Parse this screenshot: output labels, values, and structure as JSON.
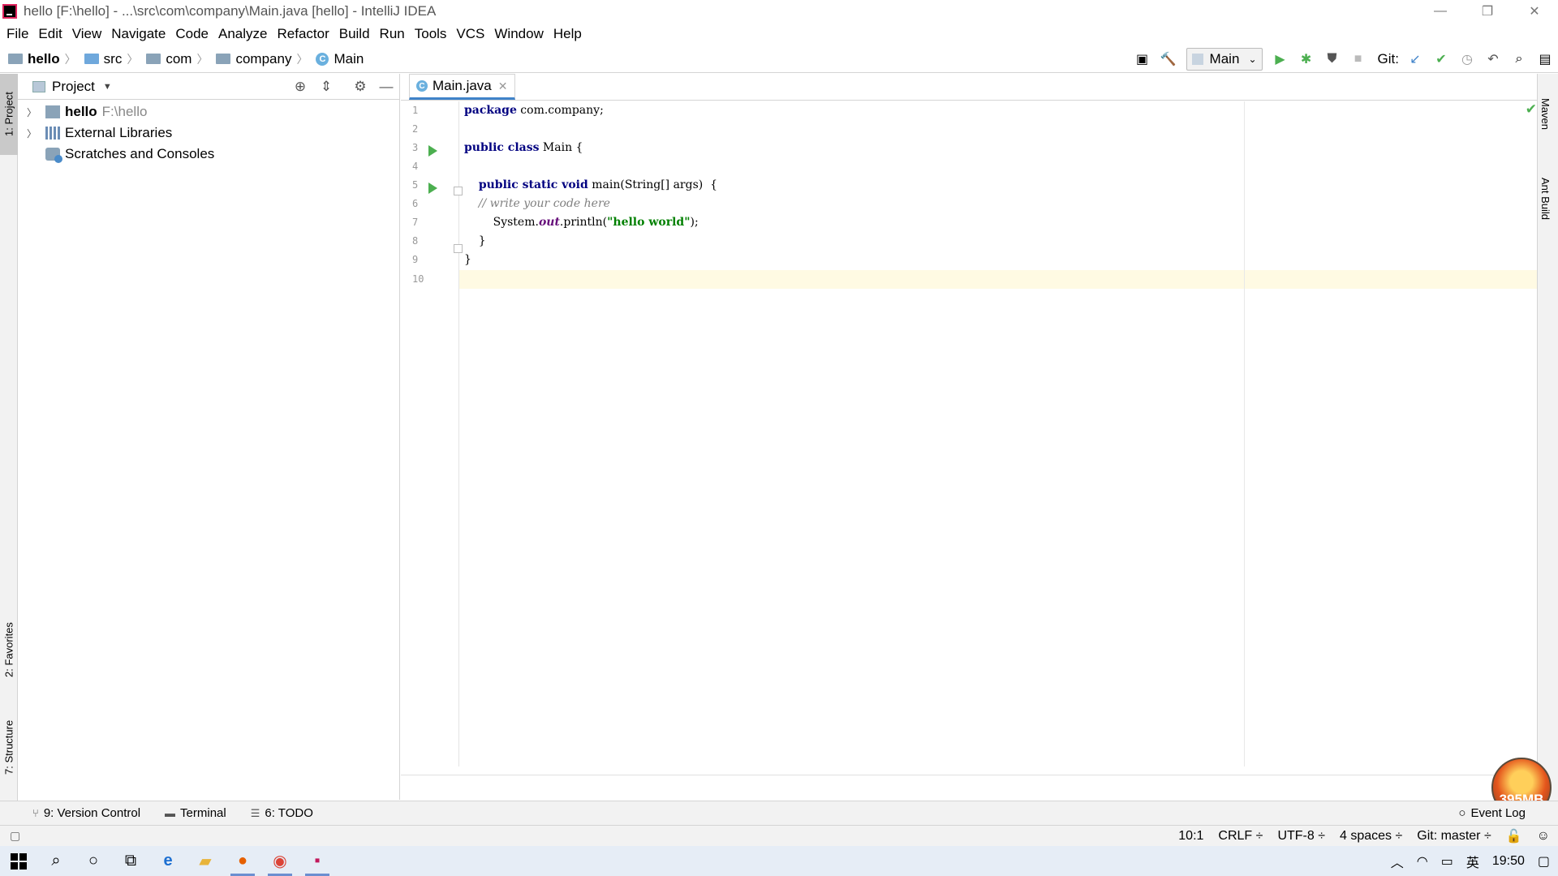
{
  "window": {
    "title": "hello [F:\\hello] - ...\\src\\com\\company\\Main.java [hello] - IntelliJ IDEA",
    "controls": [
      "—",
      "❐",
      "✕"
    ]
  },
  "menu": [
    {
      "label": "File"
    },
    {
      "label": "Edit"
    },
    {
      "label": "View"
    },
    {
      "label": "Navigate"
    },
    {
      "label": "Code"
    },
    {
      "label": "Analyze"
    },
    {
      "label": "Refactor"
    },
    {
      "label": "Build"
    },
    {
      "label": "Run"
    },
    {
      "label": "Tools"
    },
    {
      "label": "VCS"
    },
    {
      "label": "Window"
    },
    {
      "label": "Help"
    }
  ],
  "breadcrumb": {
    "project": "hello",
    "items": [
      "src",
      "com",
      "company"
    ],
    "file": "Main"
  },
  "toolbar": {
    "run_config": "Main",
    "git_label": "Git:"
  },
  "left_strip": {
    "project": "1: Project",
    "favorites": "2: Favorites",
    "structure": "7: Structure"
  },
  "right_strip": {
    "maven": "Maven",
    "ant": "Ant Build"
  },
  "project_panel": {
    "title": "Project",
    "tree": [
      {
        "name": "hello",
        "path": "F:\\hello"
      },
      {
        "name": "External Libraries"
      },
      {
        "name": "Scratches and Consoles"
      }
    ]
  },
  "editor": {
    "tab_label": "Main.java",
    "line_numbers": [
      "1",
      "2",
      "3",
      "4",
      "5",
      "6",
      "7",
      "8",
      "9",
      "10"
    ],
    "lines": {
      "l1_kw": "package",
      "l1_rest": " com.company;",
      "l3_kw": "public class",
      "l3_rest": " Main {",
      "l5_indent": "    ",
      "l5_kw": "public static void",
      "l5_rest": " main(String[] args)  {",
      "l6_comment": "    // write your code here",
      "l7_pre": "        System.",
      "l7_field": "out",
      "l7_mid": ".println(",
      "l7_str": "\"hello world\"",
      "l7_end": ");",
      "l8": "    }",
      "l9": "}"
    }
  },
  "bottom_tools": {
    "version_control": "9: Version Control",
    "terminal": "Terminal",
    "todo": "6: TODO",
    "event_log": "Event Log"
  },
  "memory": "395MB",
  "status": {
    "position": "10:1",
    "line_sep": "CRLF ÷",
    "encoding": "UTF-8 ÷",
    "indent": "4 spaces ÷",
    "git_branch": "Git: master ÷"
  },
  "taskbar": {
    "ime": "英",
    "time": "19:50"
  }
}
